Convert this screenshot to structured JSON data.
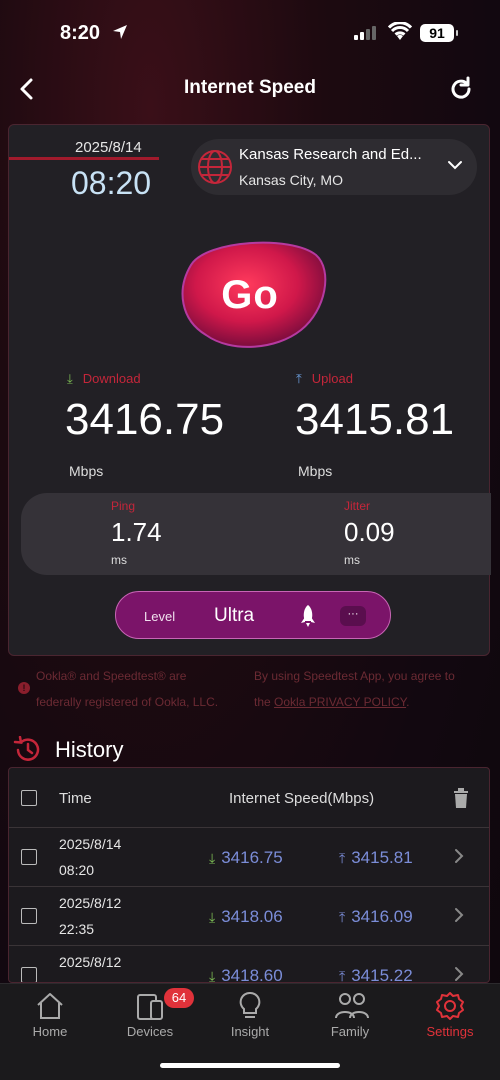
{
  "status_bar": {
    "time": "8:20",
    "battery": "91"
  },
  "nav": {
    "title": "Internet Speed"
  },
  "test": {
    "date": "2025/8/14",
    "time": "08:20",
    "server_name": "Kansas Research and Ed...",
    "server_city": "Kansas City, MO",
    "go_label": "Go",
    "download_label": "Download",
    "download_value": "3416.75",
    "download_unit": "Mbps",
    "upload_label": "Upload",
    "upload_value": "3415.81",
    "upload_unit": "Mbps",
    "ping_label": "Ping",
    "ping_value": "1.74",
    "ping_unit": "ms",
    "jitter_label": "Jitter",
    "jitter_value": "0.09",
    "jitter_unit": "ms",
    "level_label": "Level",
    "level_value": "Ultra",
    "more_label": "···"
  },
  "disclaimer": {
    "left_line1": "Ookla® and Speedtest® are",
    "left_line2": "federally registered of Ookla, LLC.",
    "right_line1": "By using Speedtest App, you agree to",
    "right_line2_prefix": "the ",
    "right_line2_link": "Ookla PRIVACY POLICY",
    "right_line2_suffix": "."
  },
  "history": {
    "title": "History",
    "col_time": "Time",
    "col_speed": "Internet Speed(Mbps)",
    "rows": [
      {
        "date": "2025/8/14",
        "time": "08:20",
        "download": "3416.75",
        "upload": "3415.81"
      },
      {
        "date": "2025/8/12",
        "time": "22:35",
        "download": "3418.06",
        "upload": "3416.09"
      },
      {
        "date": "2025/8/12",
        "time": "",
        "download": "3418.60",
        "upload": "3415.22"
      }
    ]
  },
  "tabs": {
    "home": "Home",
    "devices": "Devices",
    "devices_badge": "64",
    "insight": "Insight",
    "family": "Family",
    "settings": "Settings"
  },
  "colors": {
    "accent": "#e0323a",
    "level_bg": "#7b1469",
    "speed_value": "#7b8dd8"
  }
}
